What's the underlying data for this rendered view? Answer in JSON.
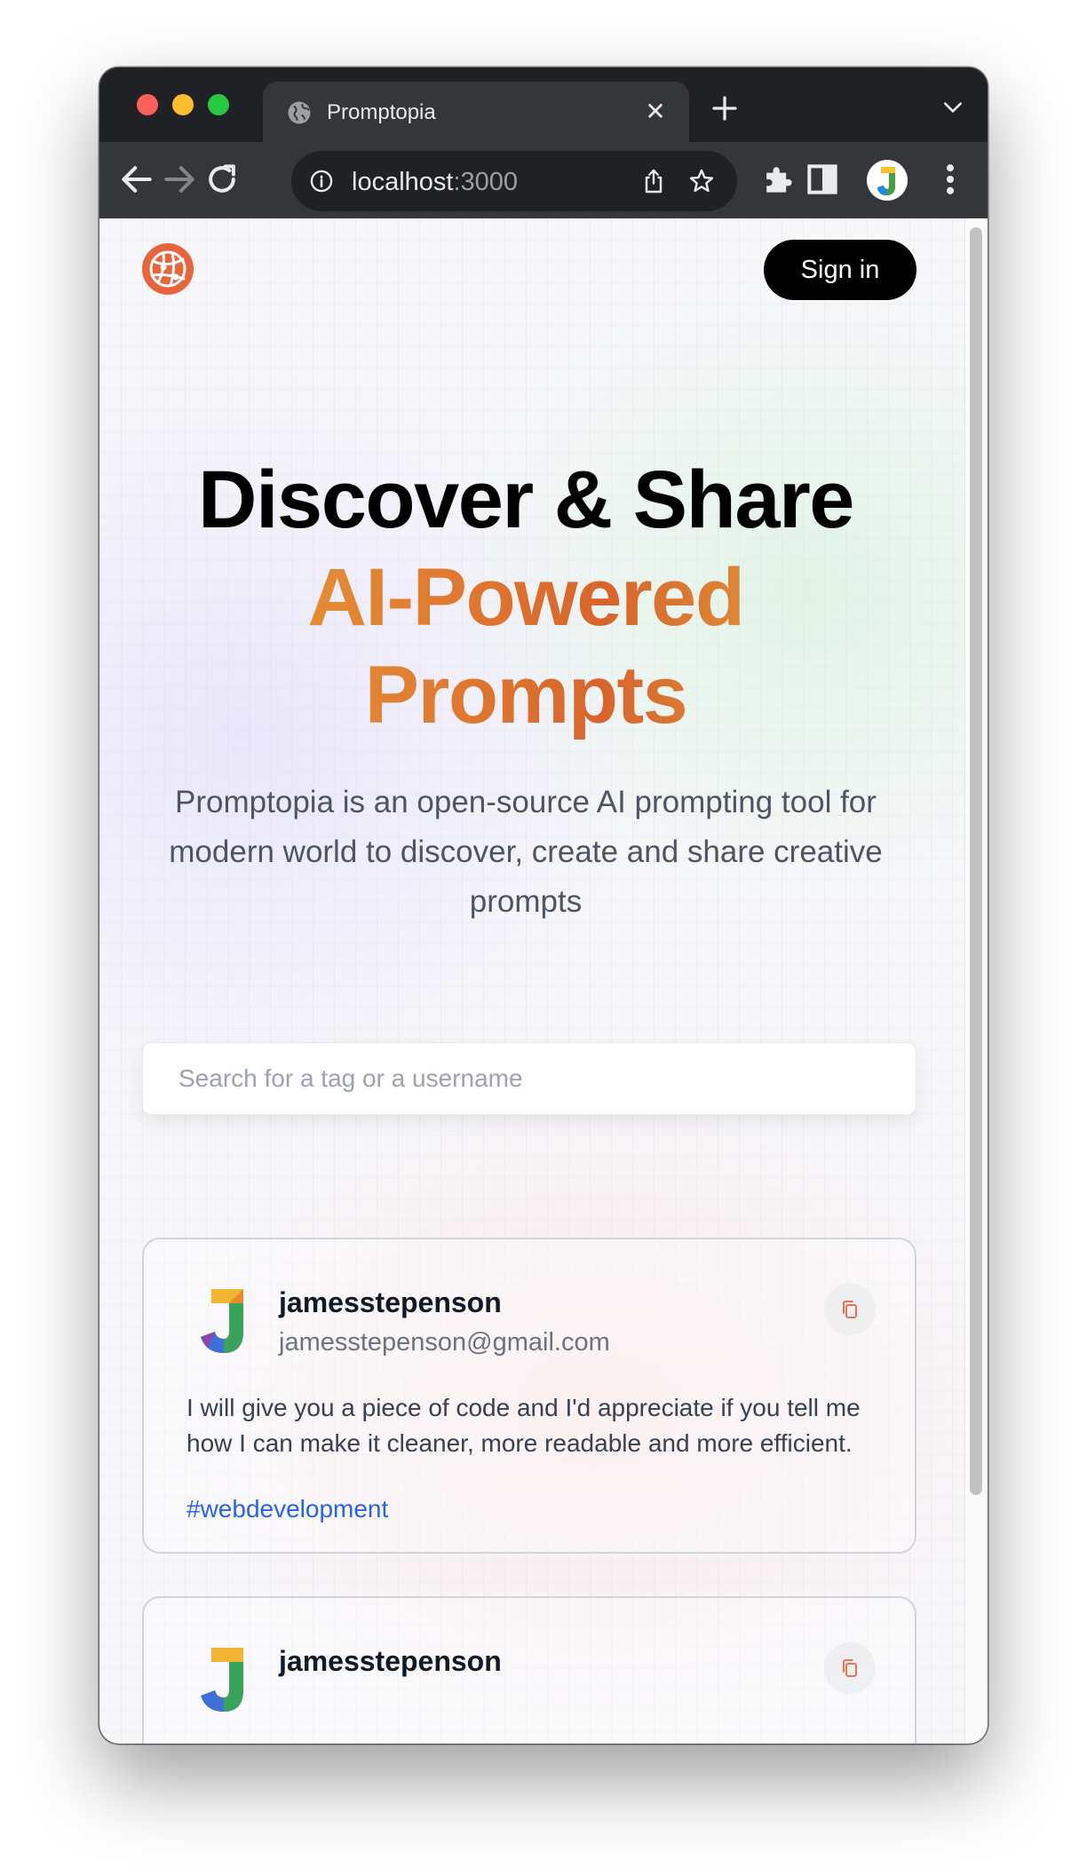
{
  "browser": {
    "tab_title": "Promptopia",
    "url_host": "localhost",
    "url_port": ":3000"
  },
  "nav": {
    "signin_label": "Sign in"
  },
  "hero": {
    "title_line1": "Discover & Share",
    "title_line2": "AI-Powered",
    "title_line3": "Prompts",
    "description": "Promptopia is an open-source AI prompting tool for modern world to discover, create and share creative prompts"
  },
  "search": {
    "placeholder": "Search for a tag or a username",
    "value": ""
  },
  "feed": {
    "cards": [
      {
        "username": "jamesstepenson",
        "email": "jamesstepenson@gmail.com",
        "prompt": "I will give you a piece of code and I'd appreciate if you tell me how I can make it cleaner, more readable and more efficient.",
        "tag": "#webdevelopment"
      },
      {
        "username": "jamesstepenson"
      }
    ]
  },
  "icons": {
    "logo": "globe-network-icon",
    "copy": "copy-icon",
    "tab_favicon": "globe-icon"
  },
  "colors": {
    "brand_orange": "#e8643a",
    "gradient_start": "#e9a23b",
    "gradient_mid": "#d9642b",
    "gradient_end": "#e2b143",
    "tag_blue": "#2563eb",
    "button_black": "#000000"
  }
}
